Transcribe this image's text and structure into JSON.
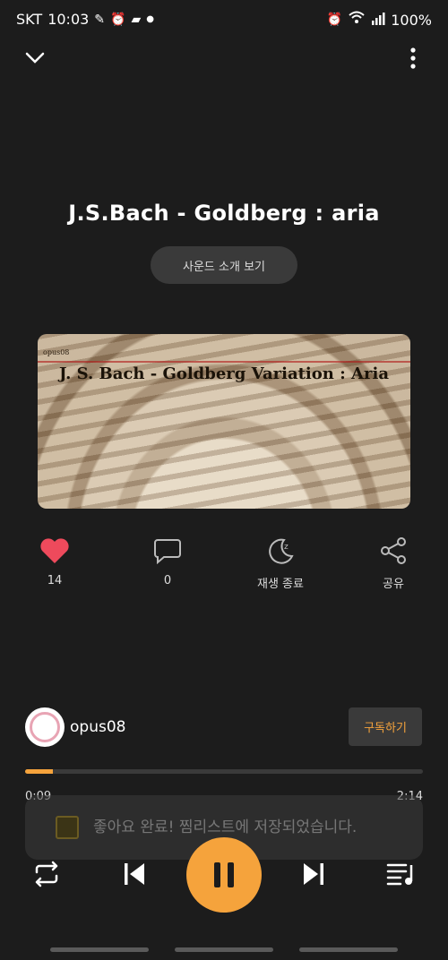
{
  "status": {
    "carrier": "SKT",
    "time": "10:03",
    "battery": "100%",
    "left_icons": [
      "pen-icon",
      "alarm-icon",
      "note-icon",
      "dot-icon"
    ],
    "right_icons": [
      "alarm-icon",
      "wifi-icon",
      "signal-icon"
    ]
  },
  "header": {
    "collapse_icon": "chevron-down-icon",
    "more_icon": "more-vertical-icon"
  },
  "track": {
    "title": "J.S.Bach - Goldberg : aria",
    "intro_button": "사운드 소개 보기",
    "cover_text": "J. S. Bach - Goldberg Variation : Aria",
    "cover_small_text": "opus08"
  },
  "actions": [
    {
      "name": "like",
      "icon": "heart-icon",
      "label": "14",
      "color": "#ee4a5c"
    },
    {
      "name": "comment",
      "icon": "comment-icon",
      "label": "0"
    },
    {
      "name": "sleep-timer",
      "icon": "moon-icon",
      "label": "재생 종료"
    },
    {
      "name": "share",
      "icon": "share-icon",
      "label": "공유"
    }
  ],
  "channel": {
    "name": "opus08",
    "subscribe_label": "구독하기"
  },
  "player": {
    "elapsed": "0:09",
    "duration": "2:14",
    "progress": 0.07,
    "accent": "#f5a33c"
  },
  "toast": {
    "message": "좋아요 완료! 찜리스트에 저장되었습니다."
  },
  "controls": {
    "repeat_icon": "repeat-icon",
    "prev_icon": "skip-previous-icon",
    "play_icon": "pause-icon",
    "next_icon": "skip-next-icon",
    "playlist_icon": "playlist-icon"
  }
}
